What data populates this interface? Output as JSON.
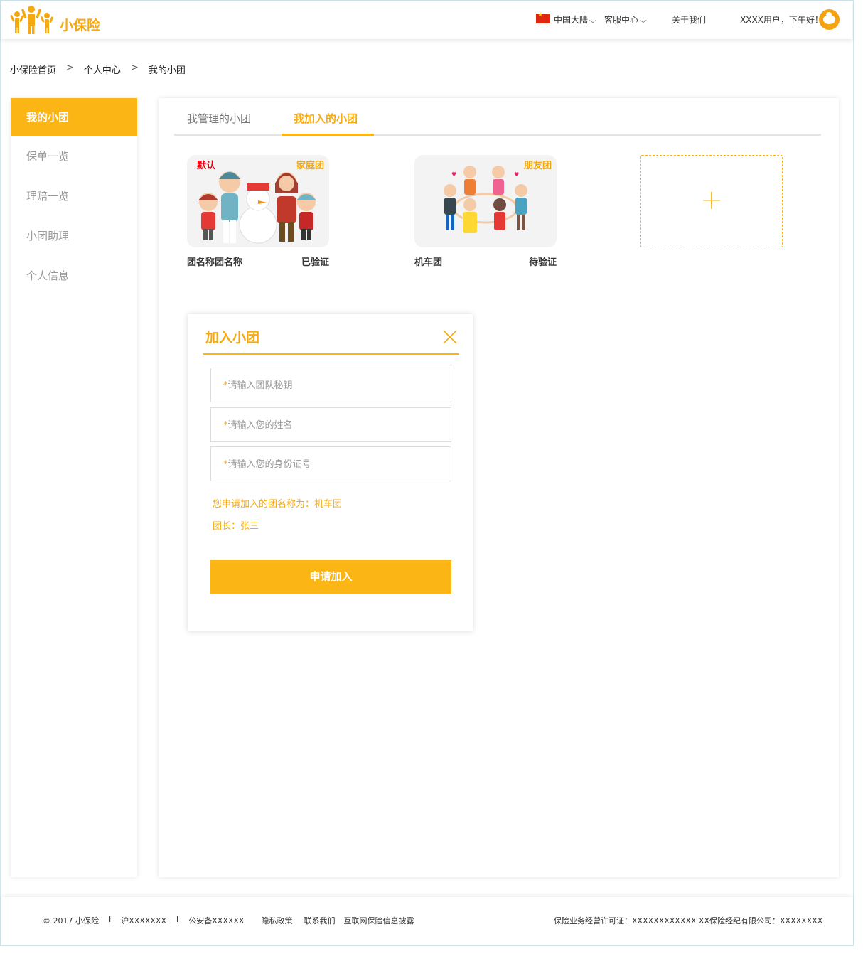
{
  "header": {
    "brand": "小保险",
    "region": "中国大陆",
    "service": "客服中心",
    "about": "关于我们",
    "greeting": "XXXX用户，下午好！"
  },
  "breadcrumb": [
    "小保险首页",
    "个人中心",
    "我的小团"
  ],
  "sidebar": {
    "items": [
      {
        "label": "我的小团",
        "active": true
      },
      {
        "label": "保单一览"
      },
      {
        "label": "理赔一览"
      },
      {
        "label": "小团助理"
      },
      {
        "label": "个人信息"
      }
    ]
  },
  "tabs": [
    {
      "label": "我管理的小团"
    },
    {
      "label": "我加入的小团",
      "active": true
    }
  ],
  "cards": [
    {
      "tag_left": "默认",
      "tag_right": "家庭团",
      "name": "团名称团名称",
      "status": "已验证",
      "image": "family-snowman-illustration"
    },
    {
      "tag_left": "",
      "tag_right": "朋友团",
      "name": "机车团",
      "status": "待验证",
      "image": "children-circle-illustration"
    }
  ],
  "add_card": {
    "symbol": "+"
  },
  "dialog": {
    "title": "加入小团",
    "fields": [
      {
        "star": "*",
        "placeholder": "请输入团队秘钥"
      },
      {
        "star": "*",
        "placeholder": "请输入您的姓名"
      },
      {
        "star": "*",
        "placeholder": "请输入您的身份证号"
      }
    ],
    "note_group": "您申请加入的团名称为：机车团",
    "note_leader": "团长：张三",
    "submit": "申请加入"
  },
  "footer": {
    "left": [
      "© 2017 小保险",
      "沪XXXXXXX",
      "公安备XXXXXX",
      "隐私政策",
      "联系我们",
      "互联网保险信息披露"
    ],
    "right": "保险业务经营许可证：XXXXXXXXXXXX  XX保险经纪有限公司：XXXXXXXX"
  },
  "colors": {
    "accent": "#fbb515",
    "accent_text": "#f5a910",
    "default_tag": "#e60012"
  }
}
